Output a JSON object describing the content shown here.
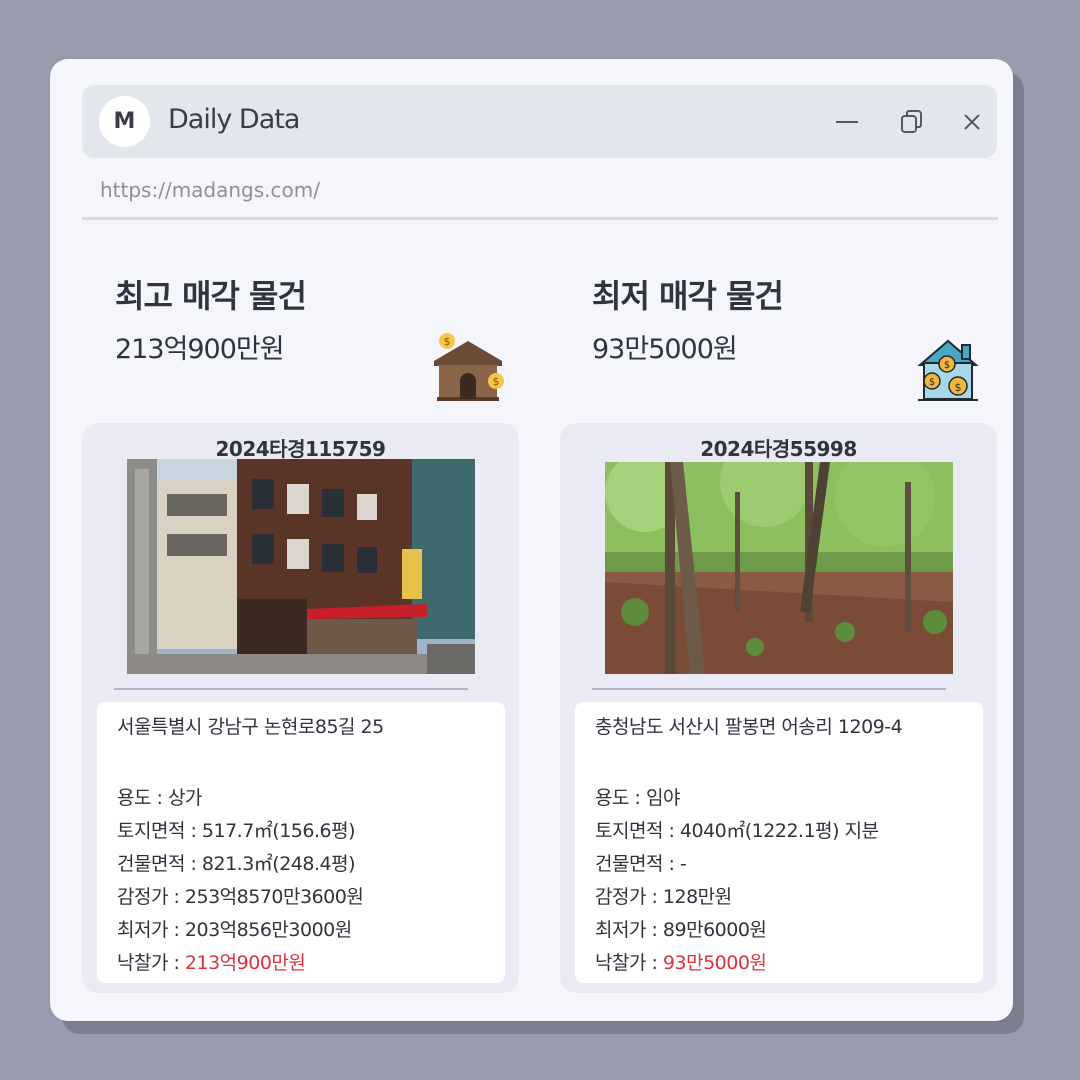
{
  "window": {
    "logo_letter": "M",
    "title": "Daily Data",
    "url": "https://madangs.com/"
  },
  "highest": {
    "heading": "최고 매각 물건",
    "price": "213억900만원",
    "icon": "house-money-icon",
    "card": {
      "case_no": "2024타경115759",
      "photo": "brick-building-photo",
      "address": "서울특별시 강남구 논현로85길 25",
      "usage_label": "용도 : ",
      "usage": "상가",
      "land_label": "토지면적 : ",
      "land": "517.7㎡(156.6평)",
      "building_label": "건물면적 : ",
      "building": "821.3㎡(248.4평)",
      "appraisal_label": "감정가 : ",
      "appraisal": "253억8570만3600원",
      "minimum_label": "최저가 : ",
      "minimum": "203억856만3000원",
      "winning_label": "낙찰가 : ",
      "winning": "213억900만원"
    }
  },
  "lowest": {
    "heading": "최저 매각 물건",
    "price": "93만5000원",
    "icon": "house-coins-icon",
    "card": {
      "case_no": "2024타경55998",
      "photo": "forest-photo",
      "address": "충청남도 서산시 팔봉면 어송리 1209-4",
      "usage_label": "용도 : ",
      "usage": " 임야",
      "land_label": "토지면적 : ",
      "land": "4040㎡(1222.1평) 지분",
      "building_label": "건물면적 : ",
      "building": "-",
      "appraisal_label": "감정가 : ",
      "appraisal": "128만원",
      "minimum_label": "최저가 : ",
      "minimum": "89만6000원",
      "winning_label": "낙찰가 : ",
      "winning": "93만5000원"
    }
  },
  "colors": {
    "background": "#999bac",
    "window": "#f5f6fb",
    "card": "#e9eaf4",
    "highlight": "#e0323c"
  }
}
